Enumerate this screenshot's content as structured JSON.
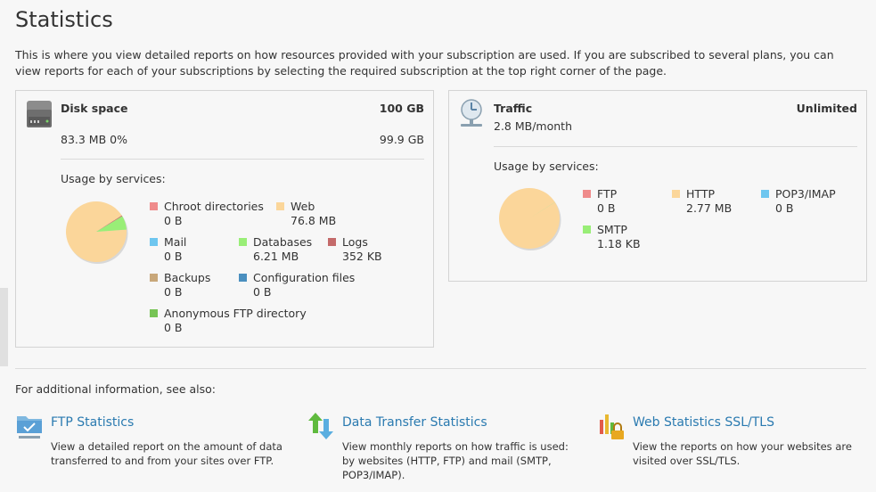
{
  "page": {
    "title": "Statistics",
    "intro": "This is where you view detailed reports on how resources provided with your subscription are used. If you are subscribed to several plans, you can view reports for each of your subscriptions by selecting the required subscription at the top right corner of the page."
  },
  "disk": {
    "title": "Disk space",
    "total": "100 GB",
    "used": "83.3 MB 0%",
    "free": "99.9 GB",
    "usage_label": "Usage by services:",
    "icon": "hard-drive-icon",
    "services": [
      {
        "name": "Chroot directories",
        "value": "0 B",
        "color": "#ef8b8b"
      },
      {
        "name": "Web",
        "value": "76.8 MB",
        "color": "#fbd69a"
      },
      {
        "name": "Mail",
        "value": "0 B",
        "color": "#6ec6ef"
      },
      {
        "name": "Databases",
        "value": "6.21 MB",
        "color": "#99ee77"
      },
      {
        "name": "Logs",
        "value": "352 KB",
        "color": "#c46a6a"
      },
      {
        "name": "Backups",
        "value": "0 B",
        "color": "#c8a77a"
      },
      {
        "name": "Configuration files",
        "value": "0 B",
        "color": "#4a8fbf"
      },
      {
        "name": "Anonymous FTP directory",
        "value": "0 B",
        "color": "#77c455"
      }
    ]
  },
  "traffic": {
    "title": "Traffic",
    "limit": "Unlimited",
    "rate": "2.8 MB/month",
    "usage_label": "Usage by services:",
    "icon": "traffic-meter-icon",
    "services": [
      {
        "name": "FTP",
        "value": "0 B",
        "color": "#ef8b8b"
      },
      {
        "name": "HTTP",
        "value": "2.77 MB",
        "color": "#fbd69a"
      },
      {
        "name": "POP3/IMAP",
        "value": "0 B",
        "color": "#6ec6ef"
      },
      {
        "name": "SMTP",
        "value": "1.18 KB",
        "color": "#99ee77"
      }
    ]
  },
  "see_also": {
    "label": "For additional information, see also:",
    "links": [
      {
        "title": "FTP Statistics",
        "desc": "View a detailed report on the amount of data transferred to and from your sites over FTP.",
        "icon": "ftp-folder-icon"
      },
      {
        "title": "Data Transfer Statistics",
        "desc": "View monthly reports on how traffic is used: by websites (HTTP, FTP) and mail (SMTP, POP3/IMAP).",
        "icon": "transfer-arrows-icon"
      },
      {
        "title": "Web Statistics SSL/TLS",
        "desc": "View the reports on how your websites are visited over SSL/TLS.",
        "icon": "secure-chart-icon"
      }
    ]
  },
  "chart_data": [
    {
      "type": "pie",
      "title": "",
      "categories": [
        "Chroot directories",
        "Web",
        "Mail",
        "Databases",
        "Logs",
        "Backups",
        "Configuration files",
        "Anonymous FTP directory"
      ],
      "values": [
        0,
        76.8,
        0,
        6.21,
        0.344,
        0,
        0,
        0
      ],
      "unit": "MB",
      "colors": [
        "#ef8b8b",
        "#fbd69a",
        "#6ec6ef",
        "#99ee77",
        "#c46a6a",
        "#c8a77a",
        "#4a8fbf",
        "#77c455"
      ]
    },
    {
      "type": "pie",
      "title": "",
      "categories": [
        "FTP",
        "HTTP",
        "POP3/IMAP",
        "SMTP"
      ],
      "values": [
        0,
        2770,
        0,
        1.18
      ],
      "unit": "KB",
      "colors": [
        "#ef8b8b",
        "#fbd69a",
        "#6ec6ef",
        "#99ee77"
      ]
    }
  ]
}
